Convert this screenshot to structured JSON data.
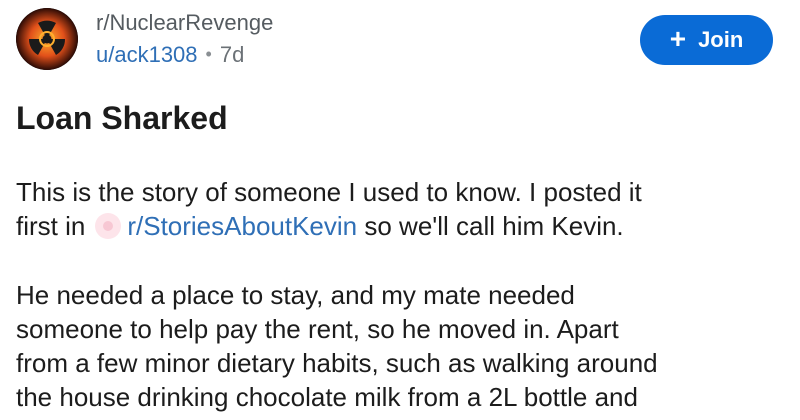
{
  "post": {
    "subreddit": "r/NuclearRevenge",
    "author": "u/ack1308",
    "separator": "•",
    "age": "7d",
    "join_label": "Join",
    "join_icon": "+",
    "title": "Loan Sharked",
    "body": {
      "p1_line1": "This is the story of someone I used to know. I posted it",
      "p1_line2_prefix": "first in",
      "p1_link": "r/StoriesAboutKevin",
      "p1_line2_suffix": "so we'll call him Kevin.",
      "p2_lines": [
        "He needed a place to stay, and my mate needed",
        "someone to help pay the rent, so he moved in. Apart",
        "from a few minor dietary habits, such as walking around",
        "the house drinking chocolate milk from a 2L bottle and"
      ]
    }
  },
  "colors": {
    "join_button": "#0a6bd6",
    "link": "#2f6fb6",
    "muted_text": "#6b7176"
  },
  "icons": {
    "avatar": "radiation-icon",
    "join": "plus-icon",
    "subreddit_link": "subreddit-icon"
  }
}
